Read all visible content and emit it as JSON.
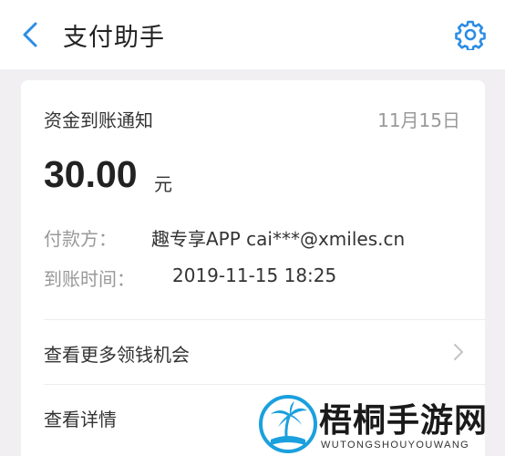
{
  "header": {
    "title": "支付助手",
    "back_icon": "chevron-left-icon",
    "settings_icon": "gear-icon",
    "accent_color": "#2a8ce5"
  },
  "notice": {
    "title": "资金到账通知",
    "date": "11月15日",
    "amount": "30.00",
    "unit": "元",
    "payer_label": "付款方：",
    "payer_value": "趣专享APP cai***@xmiles.cn",
    "time_label": "到账时间：",
    "time_value": "2019-11-15 18:25"
  },
  "links": {
    "more_label": "查看更多领钱机会",
    "detail_label": "查看详情"
  },
  "watermark": {
    "name": "梧桐手游网",
    "sub": "WUTONGSHOUYOUWANG",
    "icon": "palm-tree-logo"
  }
}
